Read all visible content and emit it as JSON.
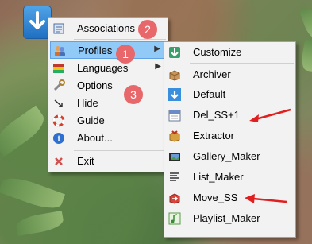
{
  "main_menu": {
    "items": [
      {
        "label": "Associations",
        "icon": "associations-icon"
      },
      {
        "label": "Profiles",
        "icon": "profiles-icon",
        "submenu": true
      },
      {
        "label": "Languages",
        "icon": "languages-icon",
        "submenu": true
      },
      {
        "label": "Options",
        "icon": "options-icon"
      },
      {
        "label": "Hide",
        "icon": "hide-icon"
      },
      {
        "label": "Guide",
        "icon": "guide-icon"
      },
      {
        "label": "About...",
        "icon": "about-icon"
      },
      {
        "label": "Exit",
        "icon": "exit-icon"
      }
    ]
  },
  "profiles_submenu": {
    "items": [
      {
        "label": "Customize",
        "icon": "customize-icon"
      },
      {
        "label": "Archiver",
        "icon": "archiver-icon"
      },
      {
        "label": "Default",
        "icon": "default-icon"
      },
      {
        "label": "Del_SS+1",
        "icon": "calendar-icon"
      },
      {
        "label": "Extractor",
        "icon": "extractor-icon"
      },
      {
        "label": "Gallery_Maker",
        "icon": "gallery-icon"
      },
      {
        "label": "List_Maker",
        "icon": "list-icon"
      },
      {
        "label": "Move_SS",
        "icon": "move-icon"
      },
      {
        "label": "Playlist_Maker",
        "icon": "playlist-icon"
      }
    ]
  },
  "badges": [
    "1",
    "2",
    "3"
  ],
  "colors": {
    "highlight": "#91c9f7",
    "badge": "#e8676a",
    "arrow": "#e02020"
  }
}
